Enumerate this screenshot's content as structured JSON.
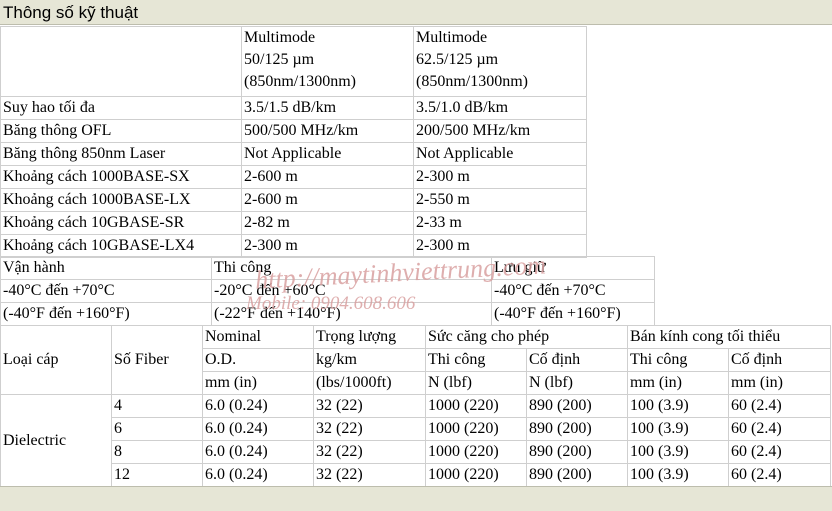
{
  "header": {
    "title": "Thông số kỹ thuật"
  },
  "spec_table": {
    "col_headers": [
      [
        "Multimode",
        "50/125 µm",
        "(850nm/1300nm)"
      ],
      [
        "Multimode",
        "62.5/125 µm",
        "(850nm/1300nm)"
      ]
    ],
    "rows": [
      [
        "Suy hao tối đa",
        "3.5/1.5 dB/km",
        "3.5/1.0 dB/km"
      ],
      [
        "Băng thông OFL",
        "500/500 MHz/km",
        "200/500 MHz/km"
      ],
      [
        "Băng thông 850nm Laser",
        "Not Applicable",
        "Not Applicable"
      ],
      [
        "Khoảng cách 1000BASE-SX",
        "2-600 m",
        "2-300 m"
      ],
      [
        "Khoảng cách 1000BASE-LX",
        "2-600 m",
        "2-550 m"
      ],
      [
        "Khoảng cách 10GBASE-SR",
        "2-82 m",
        "2-33 m"
      ],
      [
        "Khoảng cách 10GBASE-LX4",
        "2-300 m",
        "2-300 m"
      ]
    ]
  },
  "temp_table": {
    "headers": [
      "Vận hành",
      "Thi công",
      "Lưu giữ"
    ],
    "celsius": [
      "-40°C đến +70°C",
      "-20°C đến +60°C",
      "-40°C đến +70°C"
    ],
    "fahrenheit": [
      "(-40°F đến +160°F)",
      "(-22°F đến +140°F)",
      "(-40°F đến +160°F)"
    ]
  },
  "cable_table": {
    "h_cable_type": "Loại cáp",
    "h_fiber_count": "Số Fiber",
    "h_od": [
      "Nominal",
      "O.D.",
      "mm (in)"
    ],
    "h_weight": [
      "Trọng lượng",
      "kg/km",
      "(lbs/1000ft)"
    ],
    "h_tensile": "Sức căng cho phép",
    "h_tensile_install": [
      "Thi công",
      "N (lbf)"
    ],
    "h_tensile_fixed": [
      "Cố định",
      "N (lbf)"
    ],
    "h_bend": "Bán kính cong tối thiểu",
    "h_bend_install": [
      "Thi công",
      "mm (in)"
    ],
    "h_bend_fixed": [
      "Cố định",
      "mm (in)"
    ],
    "cable_type": "Dielectric",
    "rows": [
      [
        "4",
        "6.0 (0.24)",
        "32 (22)",
        "1000 (220)",
        "890 (200)",
        "100 (3.9)",
        "60 (2.4)"
      ],
      [
        "6",
        "6.0 (0.24)",
        "32 (22)",
        "1000 (220)",
        "890 (200)",
        "100 (3.9)",
        "60 (2.4)"
      ],
      [
        "8",
        "6.0 (0.24)",
        "32 (22)",
        "1000 (220)",
        "890 (200)",
        "100 (3.9)",
        "60 (2.4)"
      ],
      [
        "12",
        "6.0 (0.24)",
        "32 (22)",
        "1000 (220)",
        "890 (200)",
        "100 (3.9)",
        "60 (2.4)"
      ]
    ]
  },
  "watermark": {
    "line1": "http://maytinhviettrung.com",
    "line2": "Mobile: 0904.608.606"
  }
}
